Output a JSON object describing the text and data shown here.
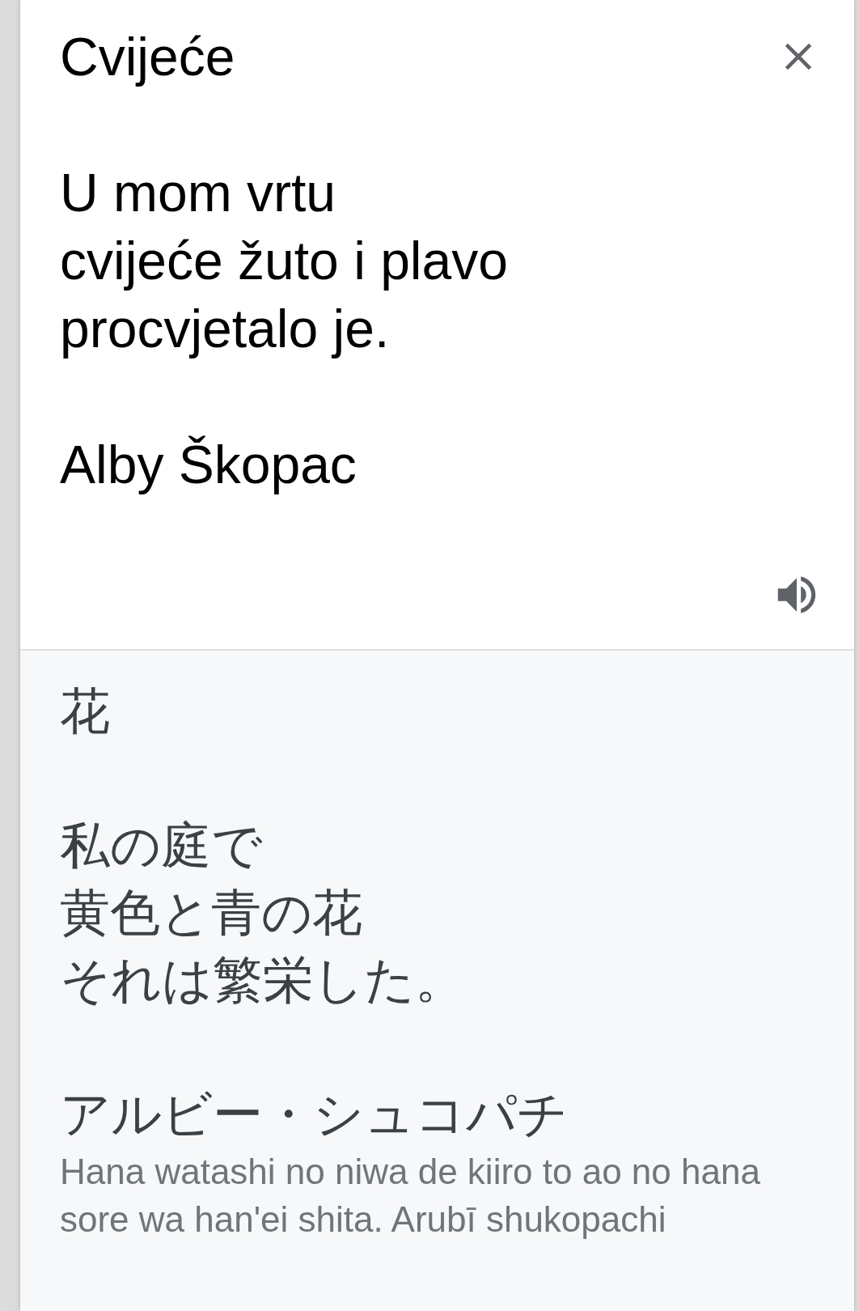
{
  "source": {
    "paragraphs": [
      [
        "Cvijeće"
      ],
      [
        "U mom vrtu",
        "cvijeće žuto i plavo",
        "procvjetalo je."
      ],
      [
        "Alby Škopac"
      ]
    ]
  },
  "translation": {
    "paragraphs": [
      [
        "花"
      ],
      [
        "私の庭で",
        "黄色と青の花",
        "それは繁栄した。"
      ],
      [
        "アルビー・シュコパチ"
      ]
    ],
    "romanization": "Hana watashi no niwa de kiiro to ao no hana sore wa han'ei shita. Arubī shukopachi"
  }
}
